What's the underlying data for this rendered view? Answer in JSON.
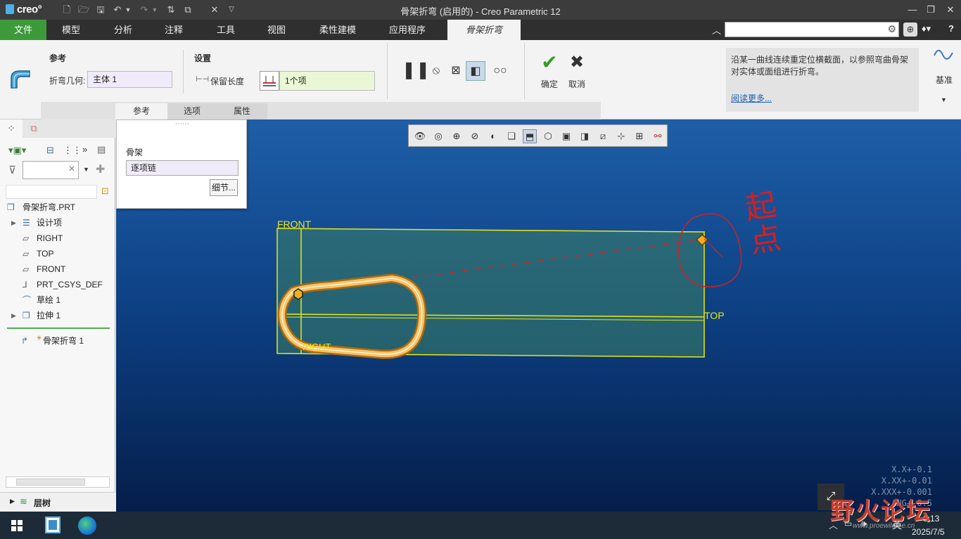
{
  "titlebar": {
    "logo": "creo",
    "title": "骨架折弯 (启用的) - Creo Parametric 12"
  },
  "menu": {
    "tabs": [
      "文件",
      "模型",
      "分析",
      "注释",
      "工具",
      "视图",
      "柔性建模",
      "应用程序",
      "骨架折弯"
    ]
  },
  "ribbon": {
    "ref_group_label": "参考",
    "bend_geometry_label": "折弯几何:",
    "bend_geometry_value": "主体 1",
    "settings_label": "设置",
    "keep_length_label": "保留长度",
    "item_count_value": "1个项",
    "ok_label": "确定",
    "cancel_label": "取消",
    "datum_label": "基准",
    "subtabs": [
      "参考",
      "选项",
      "属性"
    ],
    "info_text": "沿某一曲线连续重定位横截面，以参照弯曲骨架对实体或面组进行折弯。",
    "info_link": "阅读更多..."
  },
  "float_panel": {
    "label": "骨架",
    "field_value": "逐项链",
    "details_button": "细节..."
  },
  "model_tree": {
    "items": [
      {
        "label": "骨架折弯.PRT"
      },
      {
        "label": "设计项"
      },
      {
        "label": "RIGHT"
      },
      {
        "label": "TOP"
      },
      {
        "label": "FRONT"
      },
      {
        "label": "PRT_CSYS_DEF"
      },
      {
        "label": "草绘 1"
      },
      {
        "label": "拉伸 1"
      },
      {
        "label": "骨架折弯 1"
      }
    ],
    "layer_label": "层树"
  },
  "viewport": {
    "labels": {
      "front": "FRONT",
      "top": "TOP",
      "right": "RIGHT"
    },
    "annotation": "起点",
    "tolerances": [
      "X.X+-0.1",
      "X.XX+-0.01",
      "X.XXX+-0.001",
      "ANG+-0.5"
    ]
  },
  "taskbar": {
    "time": "0:13",
    "date": "2025/7/5",
    "ime": "英",
    "watermark": "野火论坛",
    "watermark_sub": "www.proewildfire.cn"
  },
  "colors": {
    "accent_green": "#3d9a3a",
    "menubar": "#2f2f2f",
    "plane_yellow": "#e8e81a",
    "loop_orange": "#f2b43a",
    "annotation_red": "#d22020"
  }
}
